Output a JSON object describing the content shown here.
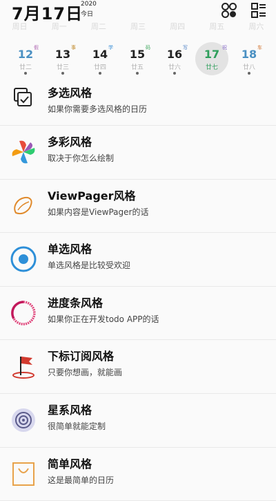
{
  "header": {
    "date": "7月17日",
    "year": "2020",
    "today": "今日"
  },
  "weekdays": [
    "周日",
    "周一",
    "周二",
    "周三",
    "周四",
    "周五",
    "周六"
  ],
  "days": [
    {
      "num": "12",
      "lunar": "廿二",
      "scheme": "假",
      "scheme_color": "#b06ab3",
      "num_color": "#4a90c2"
    },
    {
      "num": "13",
      "lunar": "廿三",
      "scheme": "事",
      "scheme_color": "#c08a2a",
      "num_color": "#222222"
    },
    {
      "num": "14",
      "lunar": "廿四",
      "scheme": "学",
      "scheme_color": "#3a8fd6",
      "num_color": "#222222"
    },
    {
      "num": "15",
      "lunar": "廿五",
      "scheme": "码",
      "scheme_color": "#3aa55a",
      "num_color": "#222222"
    },
    {
      "num": "16",
      "lunar": "廿六",
      "scheme": "写",
      "scheme_color": "#4a7fc4",
      "num_color": "#222222"
    },
    {
      "num": "17",
      "lunar": "廿七",
      "scheme": "祝",
      "scheme_color": "#8a6fc9",
      "num_color": "#2e9e5b",
      "selected": true
    },
    {
      "num": "18",
      "lunar": "廿八",
      "scheme": "车",
      "scheme_color": "#d0702a",
      "num_color": "#4a90c2"
    }
  ],
  "styles": [
    {
      "title": "多选风格",
      "sub": "如果你需要多选风格的日历",
      "icon": "multi-select-icon"
    },
    {
      "title": "多彩风格",
      "sub": "取决于你怎么绘制",
      "icon": "pinwheel-icon"
    },
    {
      "title": "ViewPager风格",
      "sub": "如果内容是ViewPager的话",
      "icon": "mango-icon"
    },
    {
      "title": "单选风格",
      "sub": "单选风格是比较受欢迎",
      "icon": "radio-icon"
    },
    {
      "title": "进度条风格",
      "sub": "如果你正在开发todo APP的话",
      "icon": "progress-ring-icon"
    },
    {
      "title": "下标订阅风格",
      "sub": "只要你想画，就能画",
      "icon": "flag-icon"
    },
    {
      "title": "星系风格",
      "sub": "很简单就能定制",
      "icon": "galaxy-icon"
    },
    {
      "title": "简单风格",
      "sub": "这是最简单的日历",
      "icon": "bag-icon"
    }
  ]
}
